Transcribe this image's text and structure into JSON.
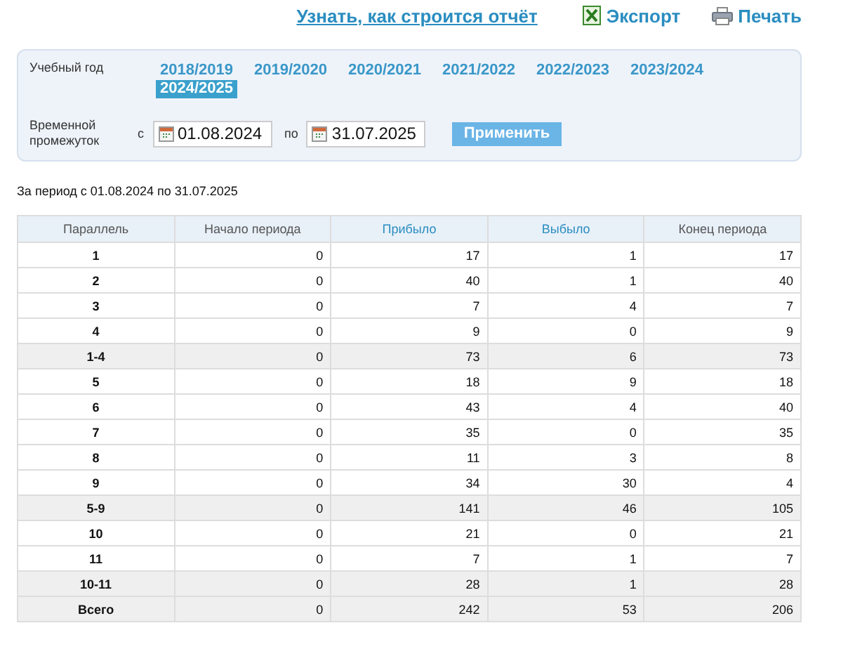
{
  "top_links": [
    {
      "kind": "help",
      "label": "Узнать, как строится отчёт"
    },
    {
      "kind": "export",
      "label": "Экспорт"
    },
    {
      "kind": "print",
      "label": "Печать"
    }
  ],
  "filter": {
    "year_label": "Учебный год",
    "years": [
      {
        "label": "2018/2019",
        "selected": false
      },
      {
        "label": "2019/2020",
        "selected": false
      },
      {
        "label": "2020/2021",
        "selected": false
      },
      {
        "label": "2021/2022",
        "selected": false
      },
      {
        "label": "2022/2023",
        "selected": false
      },
      {
        "label": "2023/2024",
        "selected": false
      },
      {
        "label": "2024/2025",
        "selected": true
      }
    ],
    "period_label": "Временной промежуток",
    "from_label": "с",
    "from": "01.08.2024",
    "to_label": "по",
    "to": "31.07.2025",
    "apply": "Применить"
  },
  "period_caption": "За период с 01.08.2024 по 31.07.2025",
  "table": {
    "columns": [
      {
        "label": "Параллель",
        "kind": "plain"
      },
      {
        "label": "Начало периода",
        "kind": "plain"
      },
      {
        "label": "Прибыло",
        "kind": "link"
      },
      {
        "label": "Выбыло",
        "kind": "link"
      },
      {
        "label": "Конец периода",
        "kind": "plain"
      }
    ],
    "rows": [
      {
        "kind": "grade",
        "cells": [
          "1",
          "0",
          "17",
          "1",
          "17"
        ]
      },
      {
        "kind": "grade",
        "cells": [
          "2",
          "0",
          "40",
          "1",
          "40"
        ]
      },
      {
        "kind": "grade",
        "cells": [
          "3",
          "0",
          "7",
          "4",
          "7"
        ]
      },
      {
        "kind": "grade",
        "cells": [
          "4",
          "0",
          "9",
          "0",
          "9"
        ]
      },
      {
        "kind": "total",
        "cells": [
          "1-4",
          "0",
          "73",
          "6",
          "73"
        ]
      },
      {
        "kind": "grade",
        "cells": [
          "5",
          "0",
          "18",
          "9",
          "18"
        ]
      },
      {
        "kind": "grade",
        "cells": [
          "6",
          "0",
          "43",
          "4",
          "40"
        ]
      },
      {
        "kind": "grade",
        "cells": [
          "7",
          "0",
          "35",
          "0",
          "35"
        ]
      },
      {
        "kind": "grade",
        "cells": [
          "8",
          "0",
          "11",
          "3",
          "8"
        ]
      },
      {
        "kind": "grade",
        "cells": [
          "9",
          "0",
          "34",
          "30",
          "4"
        ]
      },
      {
        "kind": "total",
        "cells": [
          "5-9",
          "0",
          "141",
          "46",
          "105"
        ]
      },
      {
        "kind": "grade",
        "cells": [
          "10",
          "0",
          "21",
          "0",
          "21"
        ]
      },
      {
        "kind": "grade",
        "cells": [
          "11",
          "0",
          "7",
          "1",
          "7"
        ]
      },
      {
        "kind": "total",
        "cells": [
          "10-11",
          "0",
          "28",
          "1",
          "28"
        ]
      },
      {
        "kind": "total",
        "cells": [
          "Всего",
          "0",
          "242",
          "53",
          "206"
        ]
      }
    ]
  }
}
